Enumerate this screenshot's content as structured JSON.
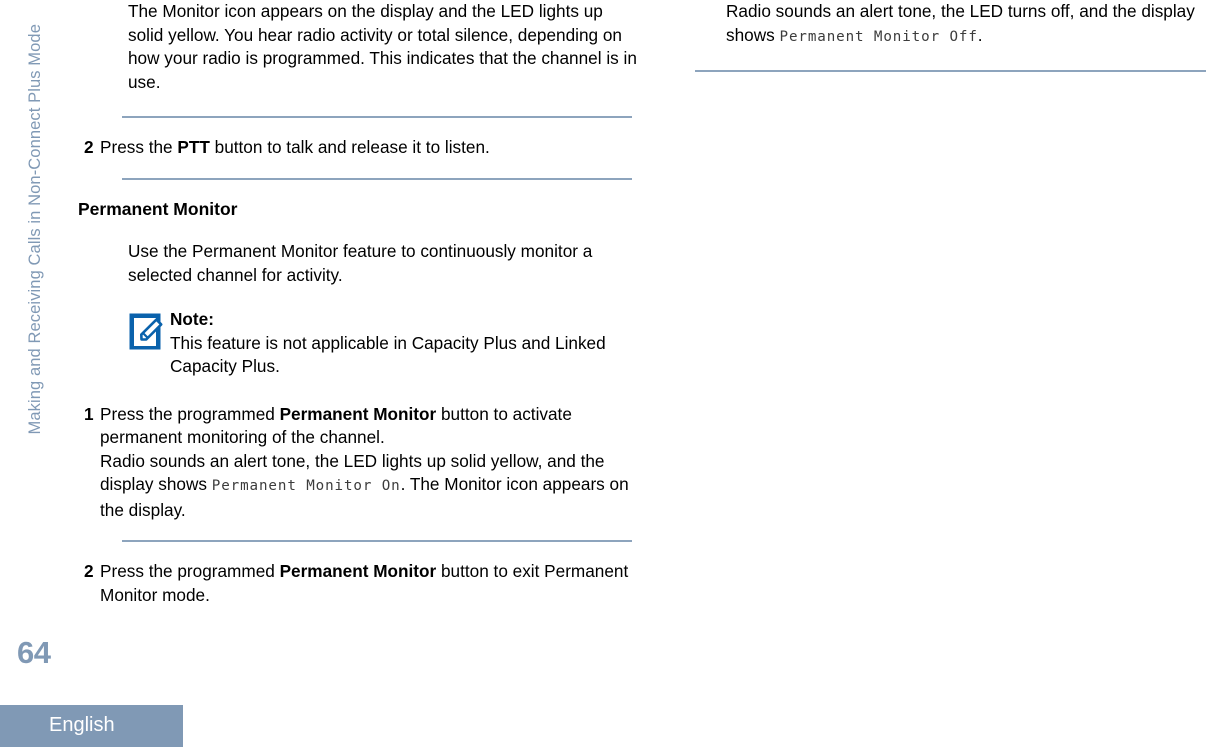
{
  "page": {
    "running_head": "Making and Receiving Calls in Non-Connect Plus Mode",
    "folio": "64",
    "language_tab": "English",
    "accent_color": "#8099b5",
    "rule_color": "#8da4bd",
    "note_icon_color": "#0a62ac",
    "screen_text_color": "#3c3c3c"
  },
  "left_column": {
    "continued_step": {
      "text": "The Monitor icon appears on the display and the LED lights up solid yellow. You hear radio activity or total silence, depending on how your radio is programmed. This indicates that the channel is in use."
    },
    "step2_monitor": {
      "number": "2",
      "text_before": "Press the ",
      "bold": "PTT",
      "text_after": " button to talk and release it to listen."
    },
    "section_heading": "Permanent Monitor",
    "intro": "Use the Permanent Monitor feature to continuously monitor a selected channel for activity.",
    "note": {
      "title": "Note:",
      "icon_name": "note-pencil-icon",
      "text": "This feature is not applicable in Capacity Plus and Linked Capacity Plus."
    },
    "step1": {
      "number": "1",
      "text_before": "Press the programmed ",
      "bold": "Permanent Monitor",
      "text_after": " button to activate permanent monitoring of the channel.",
      "result_before": "Radio sounds an alert tone, the LED lights up solid yellow, and the display shows ",
      "result_screen": "Permanent Monitor On",
      "result_after": ". The Monitor icon appears on the display."
    },
    "step2": {
      "number": "2",
      "text_before": "Press the programmed ",
      "bold": "Permanent Monitor",
      "text_after": " button to exit Permanent Monitor mode."
    }
  },
  "right_column": {
    "continued_result": {
      "text_before": "Radio sounds an alert tone, the LED turns off, and the display shows ",
      "screen": "Permanent Monitor Off",
      "text_after": "."
    }
  }
}
